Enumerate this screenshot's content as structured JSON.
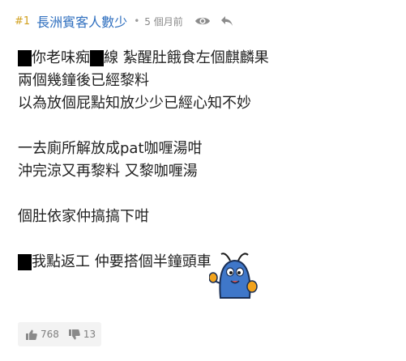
{
  "header": {
    "post_number": "#1",
    "username": "長洲賓客人數少",
    "separator": "•",
    "time": "5 個月前",
    "icons": [
      "eye-icon",
      "reply-icon"
    ]
  },
  "content": {
    "line1_a": "你老味痴",
    "line1_b": "線 紮醒肚餓食左個麒麟果",
    "line2": "兩個幾鐘後已經黎料",
    "line3": "以為放個屁點知放少少已經心知不妙",
    "line4": "一去廁所解放成pat咖喱湯咁",
    "line5": "沖完涼又再黎料 又黎咖喱湯",
    "line6": "個肚依家仲搞搞下咁",
    "line7": "我點返工 仲要搭個半鐘頭車"
  },
  "votes": {
    "upvotes": "768",
    "downvotes": "13"
  },
  "colors": {
    "username": "#2f6fbf",
    "post_number": "#d1a01e",
    "sticker_body": "#3f77c9"
  }
}
